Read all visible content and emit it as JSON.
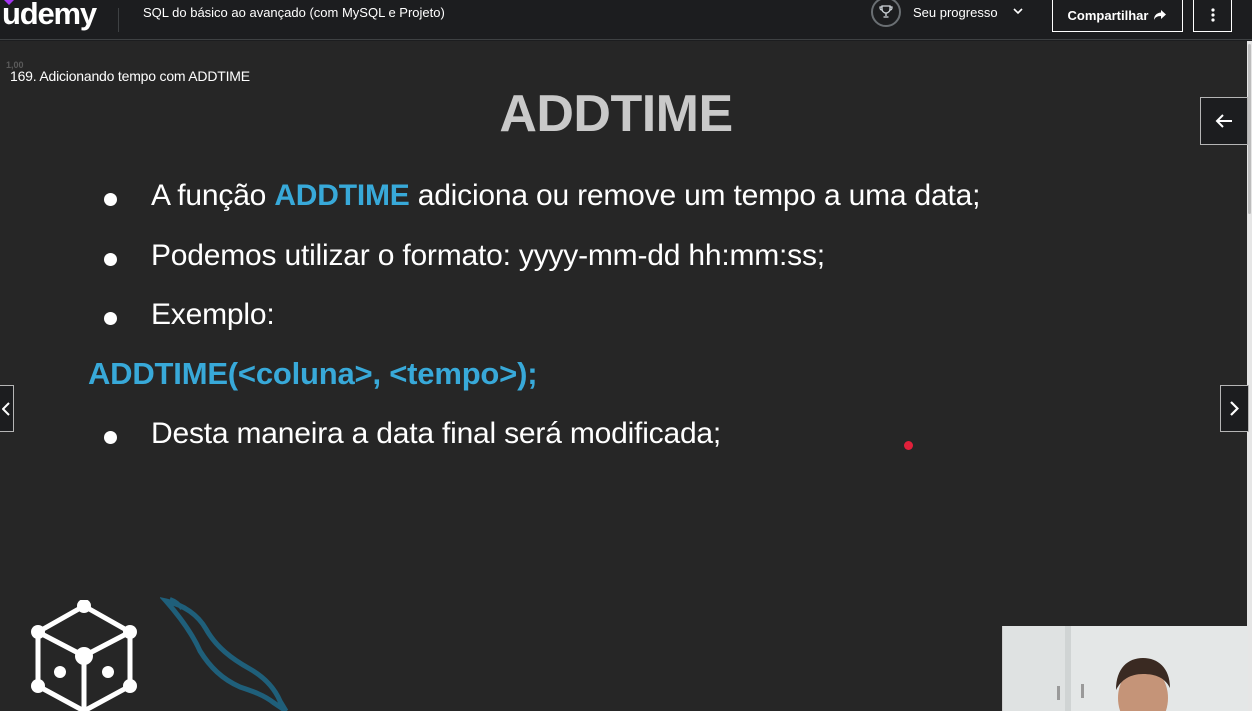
{
  "header": {
    "logo_text": "udemy",
    "course_title": "SQL do básico ao avançado (com MySQL e Projeto)",
    "progress_label": "Seu progresso",
    "share_label": "Compartilhar",
    "icons": [
      "trophy-icon",
      "chevron-down-icon",
      "share-arrow-icon",
      "more-vertical-icon"
    ]
  },
  "player": {
    "lecture_title": "169. Adicionando tempo com ADDTIME",
    "speed_ghost": "1,00",
    "icons": [
      "arrow-left-icon",
      "chevron-left-icon",
      "chevron-right-icon"
    ]
  },
  "slide": {
    "title": "ADDTIME",
    "bullet1_pre": "A função ",
    "bullet1_hl": "ADDTIME",
    "bullet1_post": " adiciona ou remove um tempo a uma data;",
    "bullet2": "Podemos utilizar o formato: yyyy-mm-dd hh:mm:ss;",
    "bullet3": "Exemplo:",
    "code": "ADDTIME(<coluna>, <tempo>);",
    "bullet4": "Desta maneira a data final será modificada;"
  },
  "colors": {
    "accent_blue": "#38a9d9",
    "brand_purple": "#a435f0",
    "pointer_red": "#e0203a",
    "slide_bg": "#262626"
  }
}
